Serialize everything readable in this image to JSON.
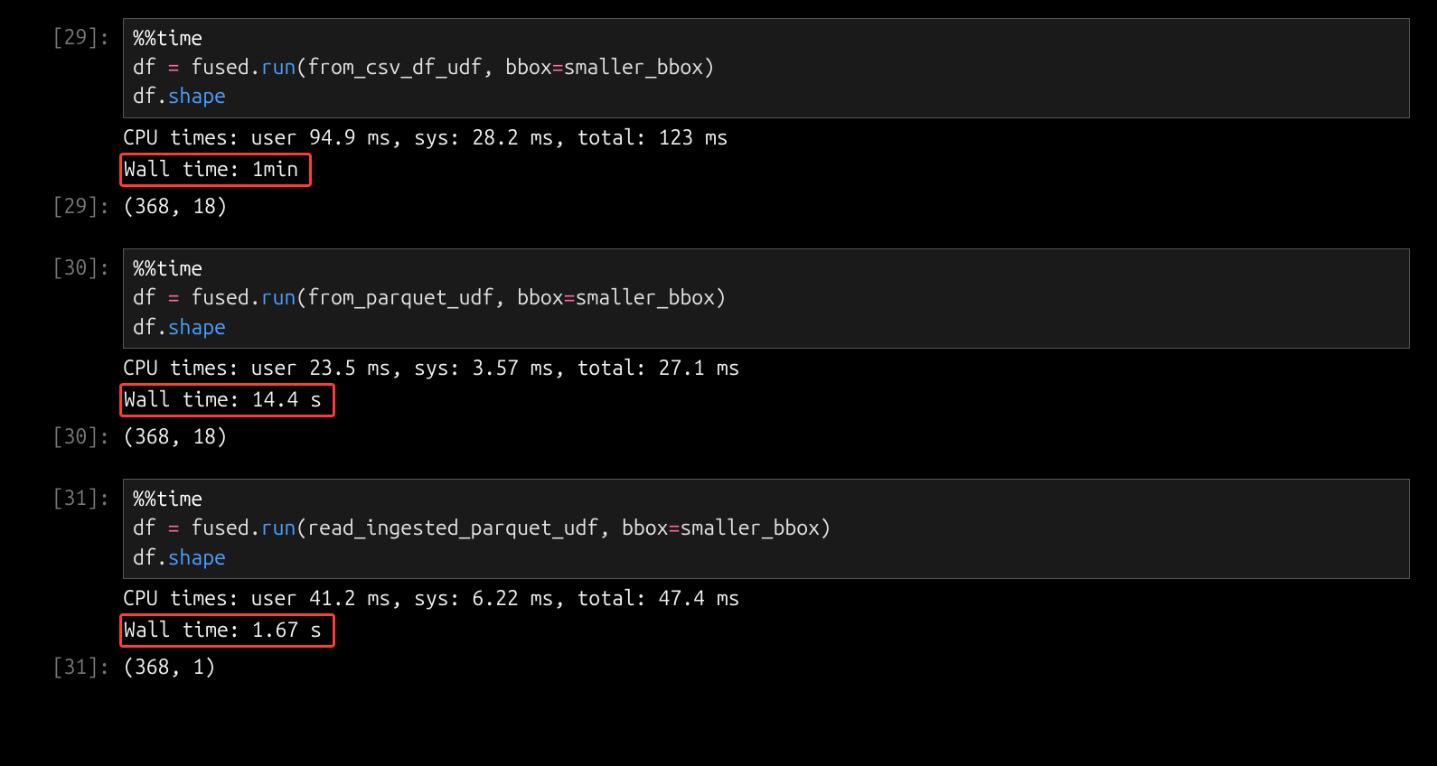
{
  "cells": [
    {
      "in_prompt": "[29]:",
      "out_prompt": "[29]:",
      "code": {
        "magic": "%%time",
        "assign": "df ",
        "eq": "=",
        "call1": " fused.",
        "fn": "run",
        "args_open": "(from_csv_df_udf, bbox",
        "eq2": "=",
        "args_close": "smaller_bbox)",
        "line3a": "df.",
        "attr": "shape"
      },
      "cpu_line": "CPU times: user 94.9 ms, sys: 28.2 ms, total: 123 ms",
      "wall_line": "Wall time: 1min",
      "result": "(368, 18)"
    },
    {
      "in_prompt": "[30]:",
      "out_prompt": "[30]:",
      "code": {
        "magic": "%%time",
        "assign": "df ",
        "eq": "=",
        "call1": " fused.",
        "fn": "run",
        "args_open": "(from_parquet_udf, bbox",
        "eq2": "=",
        "args_close": "smaller_bbox)",
        "line3a": "df.",
        "attr": "shape"
      },
      "cpu_line": "CPU times: user 23.5 ms, sys: 3.57 ms, total: 27.1 ms",
      "wall_line": "Wall time: 14.4 s",
      "result": "(368, 18)"
    },
    {
      "in_prompt": "[31]:",
      "out_prompt": "[31]:",
      "code": {
        "magic": "%%time",
        "assign": "df ",
        "eq": "=",
        "call1": " fused.",
        "fn": "run",
        "args_open": "(read_ingested_parquet_udf, bbox",
        "eq2": "=",
        "args_close": "smaller_bbox)",
        "line3a": "df.",
        "attr": "shape"
      },
      "cpu_line": "CPU times: user 41.2 ms, sys: 6.22 ms, total: 47.4 ms",
      "wall_line": "Wall time: 1.67 s",
      "result": "(368, 1)"
    }
  ]
}
